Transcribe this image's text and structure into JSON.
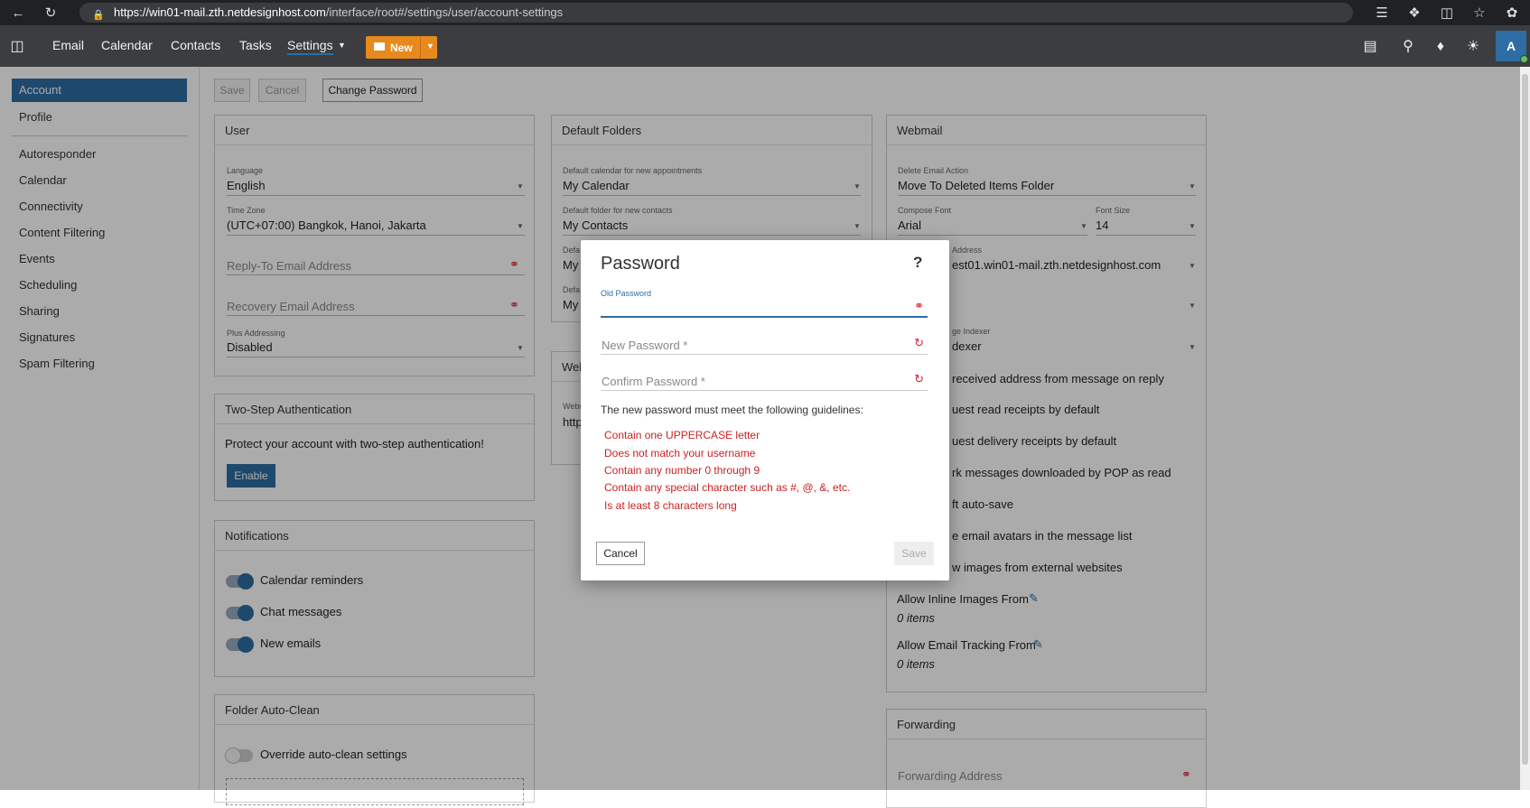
{
  "browser": {
    "url_host": "https://win01-mail.zth.netdesignhost.com",
    "url_path": "/interface/root#/settings/user/account-settings"
  },
  "nav": {
    "email": "Email",
    "calendar": "Calendar",
    "contacts": "Contacts",
    "tasks": "Tasks",
    "settings": "Settings",
    "new_label": "New",
    "avatar_initial": "A"
  },
  "sidebar": {
    "items": [
      "Account",
      "Profile",
      "Autoresponder",
      "Calendar",
      "Connectivity",
      "Content Filtering",
      "Events",
      "Scheduling",
      "Sharing",
      "Signatures",
      "Spam Filtering"
    ]
  },
  "toolbar": {
    "save": "Save",
    "cancel": "Cancel",
    "change_password": "Change Password"
  },
  "user_card": {
    "title": "User",
    "language_label": "Language",
    "language_value": "English",
    "timezone_label": "Time Zone",
    "timezone_value": "(UTC+07:00) Bangkok, Hanoi, Jakarta",
    "reply_to_placeholder": "Reply-To Email Address",
    "recovery_placeholder": "Recovery Email Address",
    "plus_label": "Plus Addressing",
    "plus_value": "Disabled"
  },
  "two_step": {
    "title": "Two-Step Authentication",
    "text": "Protect your account with two-step authentication!",
    "enable": "Enable"
  },
  "notifications": {
    "title": "Notifications",
    "items": [
      "Calendar reminders",
      "Chat messages",
      "New emails"
    ]
  },
  "auto_clean": {
    "title": "Folder Auto-Clean",
    "override": "Override auto-clean settings"
  },
  "default_folders": {
    "title": "Default Folders",
    "cal_label": "Default calendar for new appointments",
    "cal_value": "My Calendar",
    "contacts_label": "Default folder for new contacts",
    "contacts_value": "My Contacts",
    "f3_label": "Defa",
    "f3_value": "My",
    "f4_label": "Defa",
    "f4_value": "My"
  },
  "webdav_card": {
    "title": "Web",
    "label": "Webd",
    "value": "http"
  },
  "webmail": {
    "title": "Webmail",
    "delete_label": "Delete Email Action",
    "delete_value": "Move To Deleted Items Folder",
    "font_label": "Compose Font",
    "font_value": "Arial",
    "size_label": "Font Size",
    "size_value": "14",
    "address_label": "Address",
    "address_value": "est01.win01-mail.zth.netdesignhost.com",
    "indexer_label": "ge Indexer",
    "indexer_value": "dexer",
    "options": [
      "received address from message on reply",
      "uest read receipts by default",
      "uest delivery receipts by default",
      "rk messages downloaded by POP as read",
      "ft auto-save",
      "e email avatars in the message list",
      "w images from external websites"
    ],
    "inline_label": "Allow Inline Images From",
    "inline_count": "0 items",
    "tracking_label": "Allow Email Tracking From",
    "tracking_count": "0 items"
  },
  "forwarding": {
    "title": "Forwarding",
    "address_placeholder": "Forwarding Address"
  },
  "dialog": {
    "title": "Password",
    "help": "?",
    "old_label": "Old Password",
    "new_placeholder": "New Password *",
    "confirm_placeholder": "Confirm Password *",
    "guidelines": "The new password must meet the following guidelines:",
    "rules": [
      "Contain one UPPERCASE letter",
      "Does not match your username",
      "Contain any number 0 through 9",
      "Contain any special character such as #, @, &, etc.",
      "Is at least 8 characters long"
    ],
    "cancel": "Cancel",
    "save": "Save"
  },
  "colors": {
    "accent": "#2d6da3",
    "new_button": "#e8891d",
    "error": "#c22"
  }
}
